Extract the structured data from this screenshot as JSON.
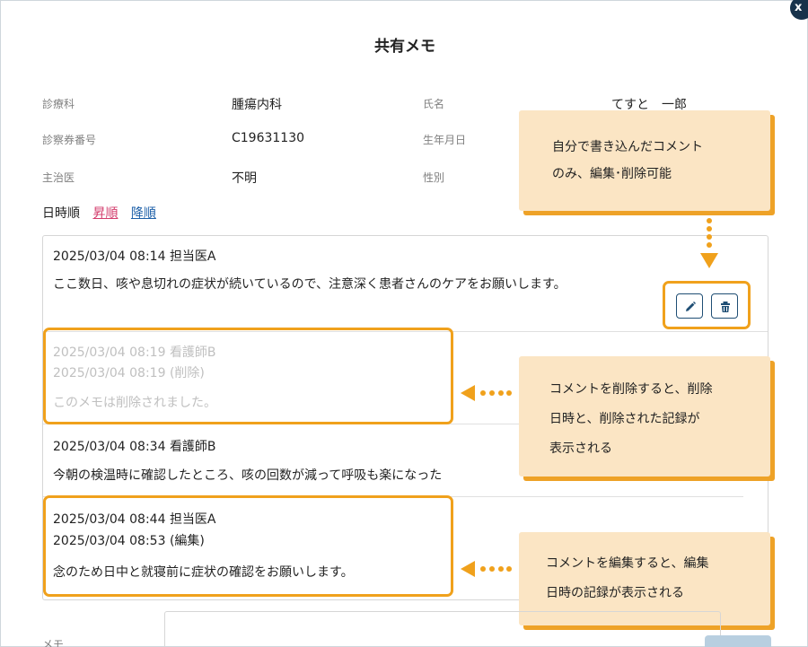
{
  "modal": {
    "title": "共有メモ",
    "close_label": "x"
  },
  "patient": {
    "department_label": "診療科",
    "department_value": "腫瘍内科",
    "name_label": "氏名",
    "name_value": "てすと　一郎",
    "card_label": "診察券番号",
    "card_value": "C19631130",
    "birth_label": "生年月日",
    "doctor_label": "主治医",
    "doctor_value": "不明",
    "sex_label": "性別"
  },
  "sort": {
    "label": "日時順",
    "asc": "昇順",
    "desc": "降順"
  },
  "memos": [
    {
      "header": "2025/03/04 08:14 担当医A",
      "body": "ここ数日、咳や息切れの症状が続いているので、注意深く患者さんのケアをお願いします。"
    },
    {
      "header": "2025/03/04 08:19 看護師B",
      "deleted_at": "2025/03/04 08:19 (削除)",
      "body": "このメモは削除されました。"
    },
    {
      "header": "2025/03/04 08:34 看護師B",
      "body": "今朝の検温時に確認したところ、咳の回数が減って呼吸も楽になった"
    },
    {
      "header": "2025/03/04 08:44 担当医A",
      "edited_at": "2025/03/04 08:53 (編集)",
      "body": "念のため日中と就寝前に症状の確認をお願いします。"
    }
  ],
  "callouts": {
    "own_comment_line1": "自分で書き込んだコメント",
    "own_comment_line2": "のみ、編集･削除可能",
    "delete_line1": "コメントを削除すると、削除",
    "delete_line2": "日時と、削除された記録が",
    "delete_line3": "表示される",
    "edit_line1": "コメントを編集すると、編集",
    "edit_line2": "日時の記録が表示される"
  },
  "memo_input": {
    "label": "メモ"
  },
  "icons": {
    "edit": "pencil-icon",
    "delete": "trash-icon",
    "close": "close-icon"
  },
  "colors": {
    "highlight": "#f0a11c",
    "callout_bg": "#fbe5c4",
    "sort_asc": "#d33c6c",
    "sort_desc": "#1c5fa8",
    "button_border": "#1f4e74"
  }
}
